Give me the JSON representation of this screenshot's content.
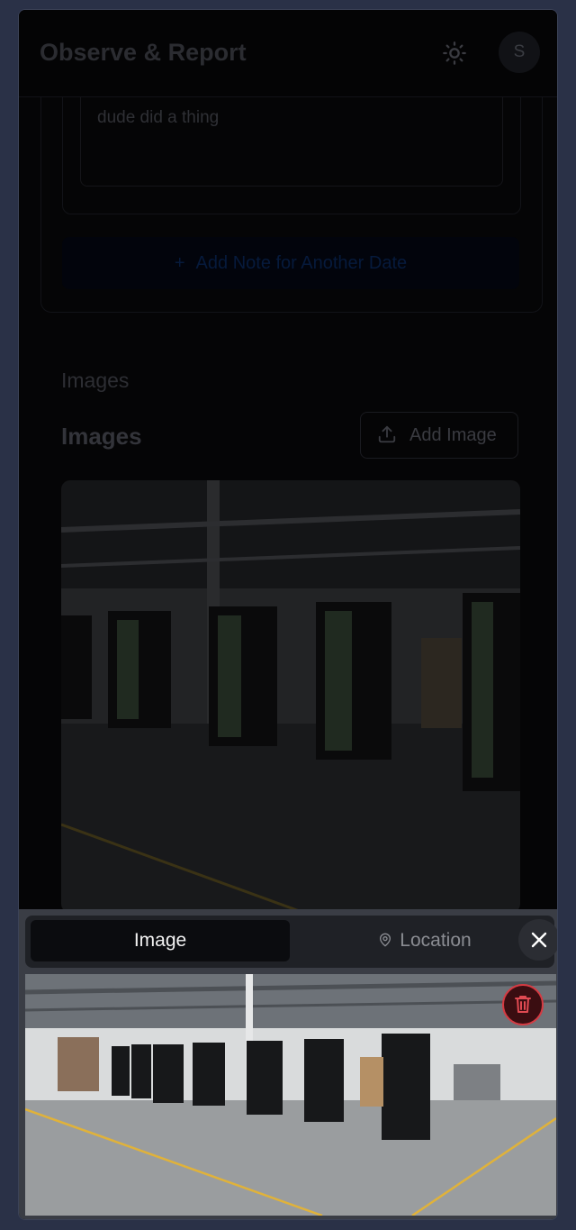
{
  "header": {
    "title": "Observe & Report",
    "avatar_initial": "S",
    "theme_icon": "sun-icon"
  },
  "note": {
    "text": "dude did a thing",
    "add_button": "Add Note for Another Date"
  },
  "images": {
    "section_label": "Images",
    "heading": "Images",
    "add_button": "Add Image"
  },
  "viewer": {
    "tabs": [
      {
        "label": "Image",
        "active": true
      },
      {
        "label": "Location",
        "active": false
      }
    ],
    "close_icon": "close-icon",
    "delete_icon": "trash-icon"
  },
  "colors": {
    "accent_blue": "#1d63d8",
    "danger": "#d43a42",
    "background": "#2a3147"
  }
}
